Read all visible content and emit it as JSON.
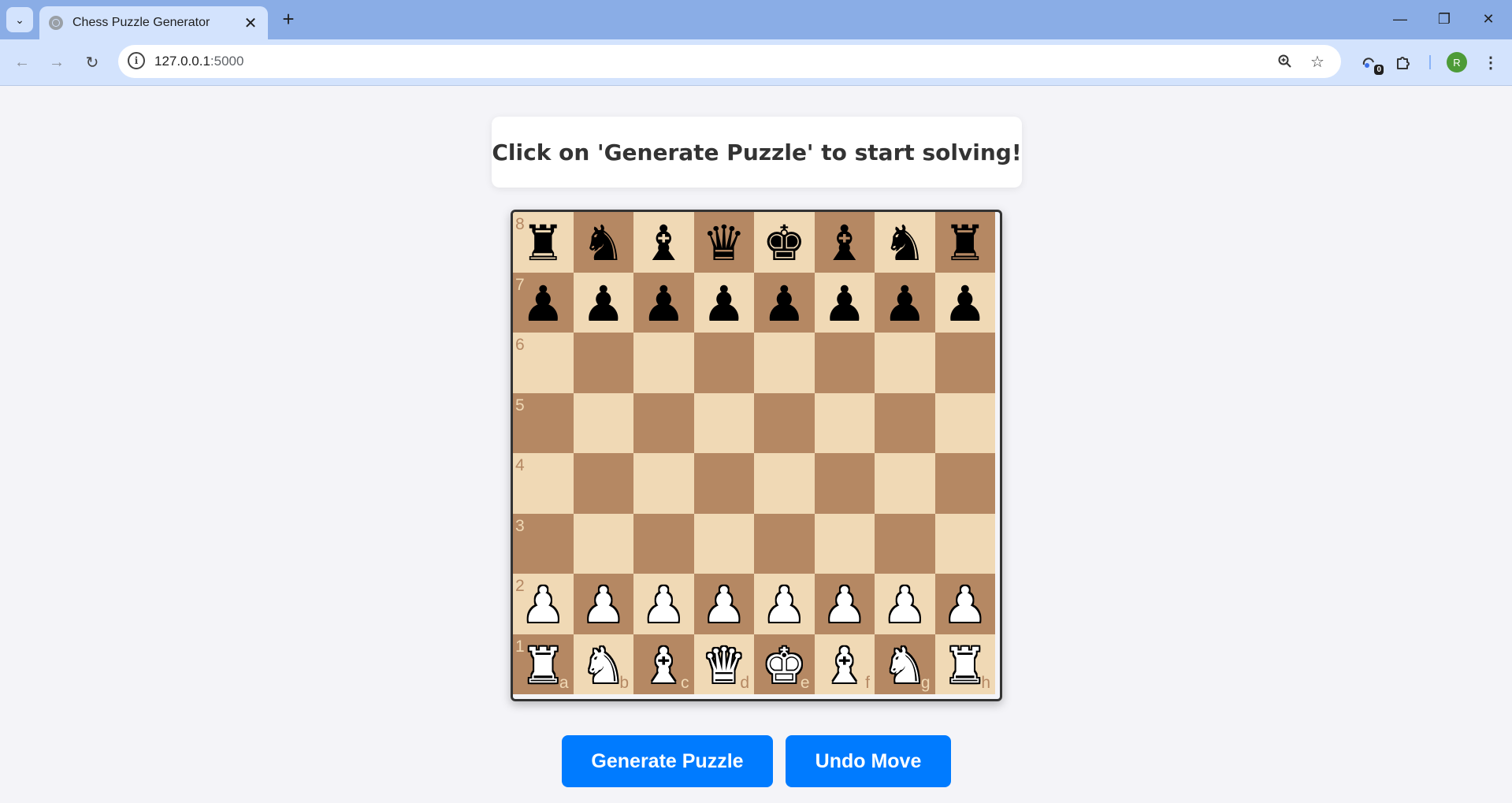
{
  "browser": {
    "tab_title": "Chess Puzzle Generator",
    "tab_close": "✕",
    "new_tab": "+",
    "url_host": "127.0.0.1",
    "url_port": ":5000",
    "extensions_badge": "0",
    "profile_initial": "R",
    "window_controls": {
      "minimize": "—",
      "restore": "❐",
      "close": "✕"
    },
    "nav": {
      "back": "←",
      "forward": "→",
      "reload": "↻"
    }
  },
  "page": {
    "message": "Click on 'Generate Puzzle' to start solving!",
    "buttons": {
      "generate": "Generate Puzzle",
      "undo": "Undo Move"
    }
  },
  "board": {
    "colors": {
      "light": "#f0d9b5",
      "dark": "#b58863"
    },
    "ranks": [
      "8",
      "7",
      "6",
      "5",
      "4",
      "3",
      "2",
      "1"
    ],
    "files": [
      "a",
      "b",
      "c",
      "d",
      "e",
      "f",
      "g",
      "h"
    ],
    "position": [
      [
        "bR",
        "bN",
        "bB",
        "bQ",
        "bK",
        "bB",
        "bN",
        "bR"
      ],
      [
        "bP",
        "bP",
        "bP",
        "bP",
        "bP",
        "bP",
        "bP",
        "bP"
      ],
      [
        "",
        "",
        "",
        "",
        "",
        "",
        "",
        ""
      ],
      [
        "",
        "",
        "",
        "",
        "",
        "",
        "",
        ""
      ],
      [
        "",
        "",
        "",
        "",
        "",
        "",
        "",
        ""
      ],
      [
        "",
        "",
        "",
        "",
        "",
        "",
        "",
        ""
      ],
      [
        "wP",
        "wP",
        "wP",
        "wP",
        "wP",
        "wP",
        "wP",
        "wP"
      ],
      [
        "wR",
        "wN",
        "wB",
        "wQ",
        "wK",
        "wB",
        "wN",
        "wR"
      ]
    ]
  },
  "accent_color": "#007bff"
}
